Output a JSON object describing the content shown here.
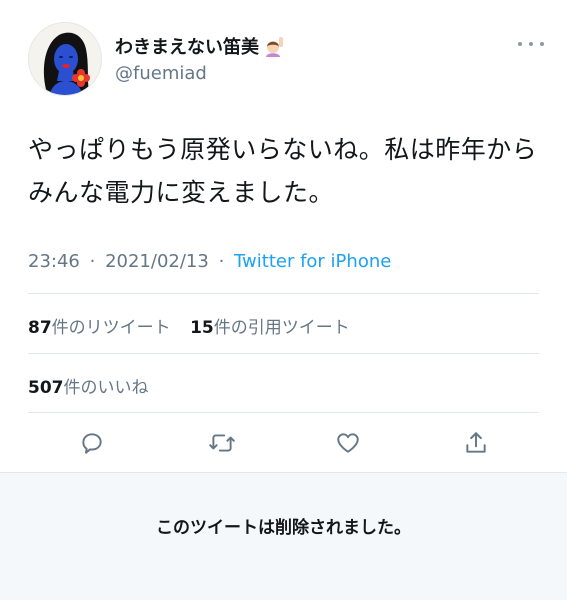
{
  "author": {
    "display_name": "わきまえない笛美",
    "emoji_icon": "woman-raising-hand-emoji",
    "handle": "@fuemiad",
    "avatar_icon": "woman-illustration-avatar"
  },
  "tweet": {
    "text": "やっぱりもう原発いらないね。私は昨年からみんな電力に変えました。",
    "time": "23:46",
    "date": "2021/02/13",
    "separator": "·",
    "source": "Twitter for iPhone"
  },
  "stats": {
    "retweets_count": "87",
    "retweets_label": "件のリツイート",
    "quotes_count": "15",
    "quotes_label": "件の引用ツイート",
    "likes_count": "507",
    "likes_label": "件のいいね"
  },
  "actions": {
    "reply_icon": "reply-icon",
    "retweet_icon": "retweet-icon",
    "like_icon": "heart-icon",
    "share_icon": "share-icon",
    "more_icon": "more-icon"
  },
  "deleted_notice": "このツイートは削除されました。",
  "colors": {
    "text": "#14171a",
    "secondary": "#657786",
    "link": "#1da1f2",
    "divider": "#e1e8ed",
    "icon": "#657786",
    "deleted_bg": "#f5f8fa"
  }
}
